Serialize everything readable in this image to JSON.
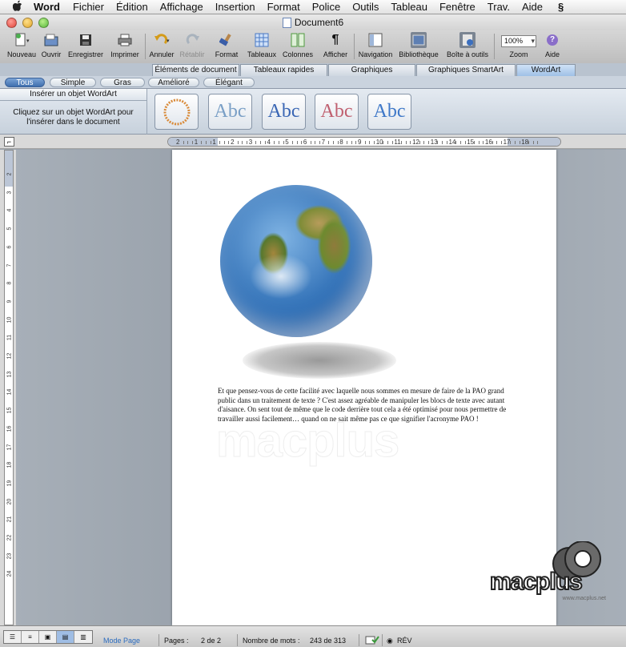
{
  "menubar": {
    "app_name": "Word",
    "items": [
      "Fichier",
      "Édition",
      "Affichage",
      "Insertion",
      "Format",
      "Police",
      "Outils",
      "Tableau",
      "Fenêtre",
      "Trav.",
      "Aide"
    ]
  },
  "window": {
    "title": "Document6"
  },
  "toolbar": {
    "new": "Nouveau",
    "open": "Ouvrir",
    "save": "Enregistrer",
    "print": "Imprimer",
    "undo": "Annuler",
    "redo": "Rétablir",
    "format": "Format",
    "tables": "Tableaux",
    "columns": "Colonnes",
    "show": "Afficher",
    "navigation": "Navigation",
    "library": "Bibliothèque",
    "toolbox": "Boîte à outils",
    "zoom_label": "Zoom",
    "zoom_value": "100%",
    "help": "Aide"
  },
  "gallery_tabs": [
    "Éléments de document",
    "Tableaux rapides",
    "Graphiques",
    "Graphiques SmartArt",
    "WordArt"
  ],
  "categories": [
    "Tous",
    "Simple",
    "Gras",
    "Amélioré",
    "Élégant"
  ],
  "gallery": {
    "header": "Insérer un objet WordArt",
    "description": "Cliquez sur un objet WordArt pour l'insérer dans le document",
    "thumb_text": "Abc",
    "thumb_colors": [
      "#7a9fc6",
      "#3a66b4",
      "#c06070",
      "#3f78c8"
    ]
  },
  "ruler": {
    "h_numbers": [
      "2",
      "1",
      "1",
      "2",
      "3",
      "4",
      "5",
      "6",
      "7",
      "8",
      "9",
      "10",
      "11",
      "12",
      "13",
      "14",
      "15",
      "16",
      "17",
      "18"
    ],
    "v_numbers": [
      "2",
      "3",
      "4",
      "5",
      "6",
      "7",
      "8",
      "9",
      "10",
      "11",
      "12",
      "13",
      "14",
      "15",
      "16",
      "17",
      "18",
      "19",
      "20",
      "21",
      "22",
      "23",
      "24"
    ]
  },
  "document": {
    "body": "Et que pensez-vous de cette facilité avec laquelle nous sommes en mesure de faire de la PAO grand public dans un traitement de texte ? C'est assez agréable de manipuler les blocs de texte avec autant d'aisance. On sent tout de même que le code derrière tout cela a été optimisé pour nous permettre de travailler aussi facilement… quand on ne sait même pas ce que signifier l'acronyme PAO !",
    "watermark": "macplus"
  },
  "logo": {
    "text": "macplus",
    "url": "www.macplus.net"
  },
  "statusbar": {
    "mode": "Mode Page",
    "pages_label": "Pages :",
    "pages_value": "2 de 2",
    "words_label": "Nombre de mots :",
    "words_value": "243 de 313",
    "rev": "RÉV"
  }
}
